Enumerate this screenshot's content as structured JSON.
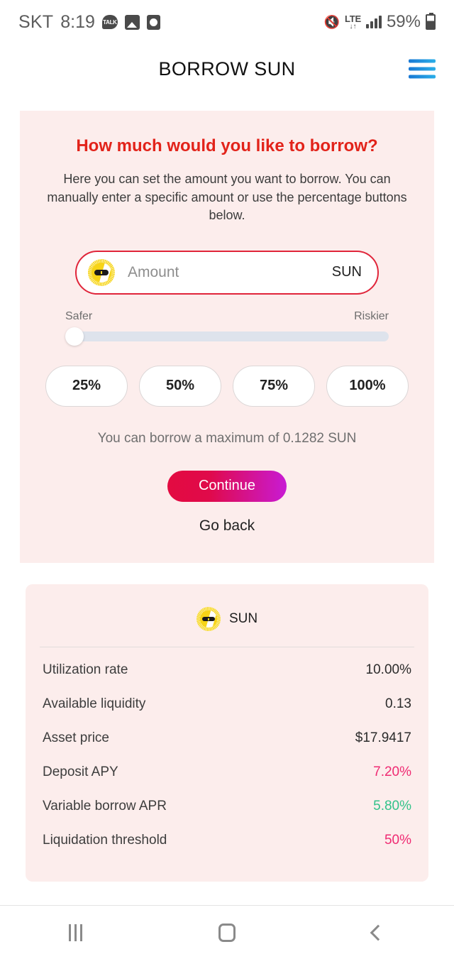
{
  "status_bar": {
    "carrier": "SKT",
    "time": "8:19",
    "icons_left": [
      "kakaotalk-icon",
      "gallery-icon",
      "clock-icon"
    ],
    "mute_icon": "✕",
    "network_type": "LTE",
    "network_arrows": "↓↑",
    "battery_percent": "59%"
  },
  "header": {
    "title": "BORROW SUN",
    "menu_icon": "hamburger-icon"
  },
  "borrow_card": {
    "heading": "How much would you like to borrow?",
    "description": "Here you can set the amount you want to borrow. You can manually enter a specific amount or use the percentage buttons below.",
    "amount_input": {
      "value": "",
      "placeholder": "Amount",
      "unit": "SUN",
      "token_icon": "sun-token-icon"
    },
    "slider": {
      "left_label": "Safer",
      "right_label": "Riskier",
      "value_percent": 0
    },
    "percent_buttons": [
      "25%",
      "50%",
      "75%",
      "100%"
    ],
    "max_note": "You can borrow a maximum of 0.1282 SUN",
    "continue_label": "Continue",
    "go_back_label": "Go back"
  },
  "stats_card": {
    "token_icon": "sun-token-icon",
    "token_symbol": "SUN",
    "rows": [
      {
        "label": "Utilization rate",
        "value": "10.00%",
        "color": "#2b2b2b"
      },
      {
        "label": "Available liquidity",
        "value": "0.13",
        "color": "#2b2b2b"
      },
      {
        "label": "Asset price",
        "value": "$17.9417",
        "color": "#2b2b2b"
      },
      {
        "label": "Deposit APY",
        "value": "7.20%",
        "color": "#ef2a72"
      },
      {
        "label": "Variable borrow APR",
        "value": "5.80%",
        "color": "#32c28a"
      },
      {
        "label": "Liquidation threshold",
        "value": "50%",
        "color": "#ef2a72"
      }
    ]
  },
  "nav_bar": {
    "recents_icon": "recents-icon",
    "home_icon": "home-icon",
    "back_icon": "back-icon"
  },
  "colors": {
    "card_bg": "#FCEDEC",
    "accent_red": "#e2231a",
    "input_border": "#e0253a",
    "cta_gradient_start": "#e30b41",
    "cta_gradient_end": "#c81bd4",
    "menu_gradient_start": "#1878d4",
    "menu_gradient_end": "#2aaee8"
  }
}
